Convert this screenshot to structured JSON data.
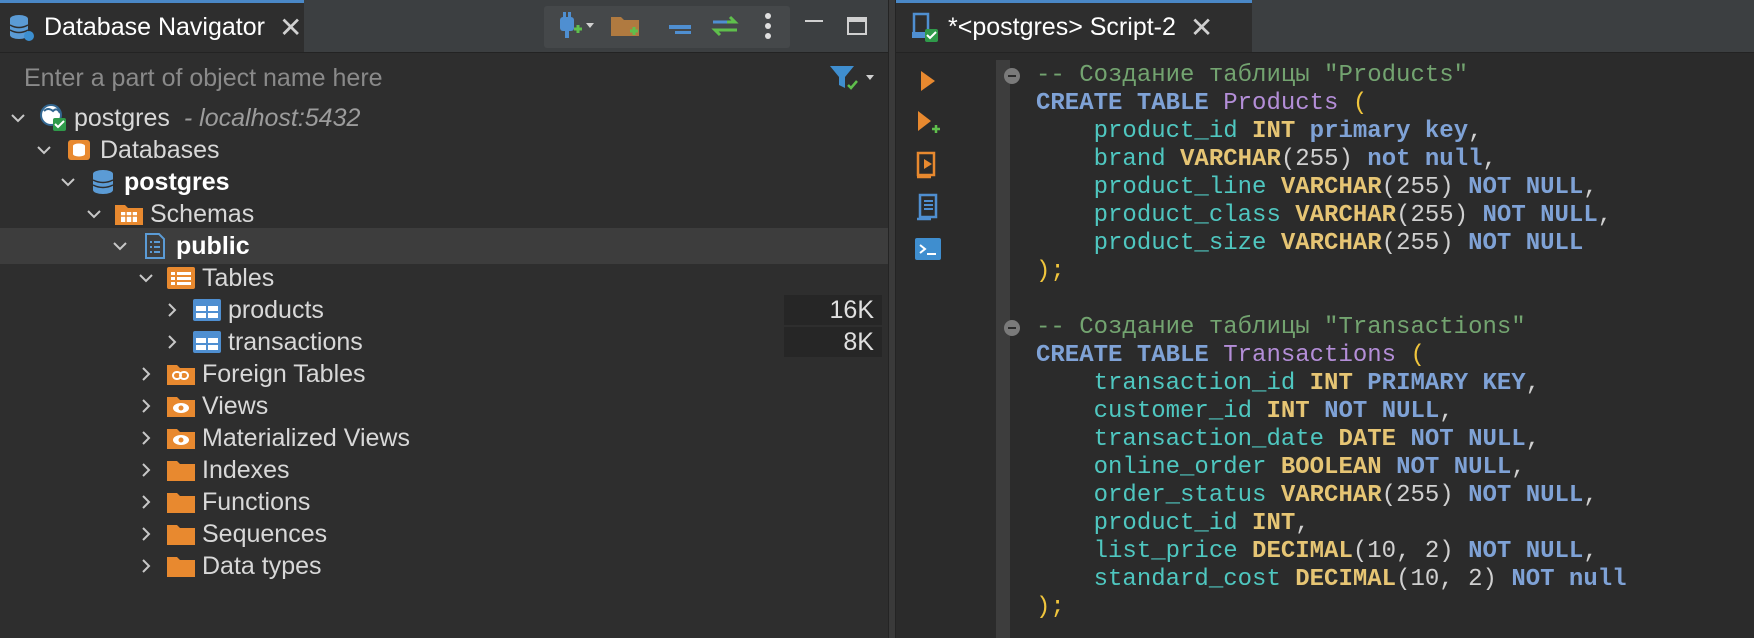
{
  "navigator": {
    "tab_title": "Database Navigator",
    "filter_placeholder": "Enter a part of object name here",
    "tree": [
      {
        "label": "postgres",
        "host": "- localhost:5432"
      },
      {
        "label": "Databases"
      },
      {
        "label": "postgres"
      },
      {
        "label": "Schemas"
      },
      {
        "label": "public"
      },
      {
        "label": "Tables"
      },
      {
        "label": "products",
        "size": "16K"
      },
      {
        "label": "transactions",
        "size": "8K"
      },
      {
        "label": "Foreign Tables"
      },
      {
        "label": "Views"
      },
      {
        "label": "Materialized Views"
      },
      {
        "label": "Indexes"
      },
      {
        "label": "Functions"
      },
      {
        "label": "Sequences"
      },
      {
        "label": "Data types"
      }
    ]
  },
  "editor": {
    "tab_title": "*<postgres> Script-2",
    "lines": {
      "l1_comment": "-- Создание таблицы \"Products\"",
      "l2_kw": "CREATE TABLE",
      "l2_name": "Products",
      "l3_col": "product_id",
      "l3_type": "INT",
      "l3_kw": "primary key",
      "l4_col": "brand",
      "l4_type": "VARCHAR",
      "l4_len": "255",
      "l4_kw": "not null",
      "l5_col": "product_line",
      "l5_type": "VARCHAR",
      "l5_len": "255",
      "l5_kw": "NOT NULL",
      "l6_col": "product_class",
      "l6_type": "VARCHAR",
      "l6_len": "255",
      "l6_kw": "NOT NULL",
      "l7_col": "product_size",
      "l7_type": "VARCHAR",
      "l7_len": "255",
      "l7_kw": "NOT NULL",
      "l8_close": ");",
      "l10_comment": "-- Создание таблицы \"Transactions\"",
      "l11_kw": "CREATE TABLE",
      "l11_name": "Transactions",
      "l12_col": "transaction_id",
      "l12_type": "INT",
      "l12_kw": "PRIMARY KEY",
      "l13_col": "customer_id",
      "l13_type": "INT",
      "l13_kw": "NOT NULL",
      "l14_col": "transaction_date",
      "l14_type": "DATE",
      "l14_kw": "NOT NULL",
      "l15_col": "online_order",
      "l15_type": "BOOLEAN",
      "l15_kw": "NOT NULL",
      "l16_col": "order_status",
      "l16_type": "VARCHAR",
      "l16_len": "255",
      "l16_kw": "NOT NULL",
      "l17_col": "product_id",
      "l17_type": "INT",
      "l18_col": "list_price",
      "l18_type": "DECIMAL",
      "l18_args": "10, 2",
      "l18_kw": "NOT NULL",
      "l19_col": "standard_cost",
      "l19_type": "DECIMAL",
      "l19_args": "10, 2",
      "l19_kw": "NOT null",
      "l20_close": ");"
    }
  },
  "colors": {
    "accent": "#4a88c7",
    "folder": "#e8892f",
    "comment": "#73a470",
    "keyword": "#7fa2d6",
    "type": "#e6c574",
    "column": "#4fc7c0",
    "table_name": "#b48ed8"
  },
  "icons": {
    "navigator_tab": "database-stack-icon",
    "connect": "plug-add-icon",
    "new_folder": "folder-add-icon",
    "collapse": "collapse-all-icon",
    "link": "link-with-editor-icon",
    "menu": "kebab-menu-icon",
    "minimize": "minimize-icon",
    "maximize": "maximize-icon",
    "filter": "filter-icon",
    "script_tab": "sql-script-icon",
    "run": "run-icon",
    "run_new_tab": "run-new-tab-icon",
    "execute_script": "execute-script-icon",
    "explain": "explain-plan-icon",
    "console": "console-icon"
  }
}
